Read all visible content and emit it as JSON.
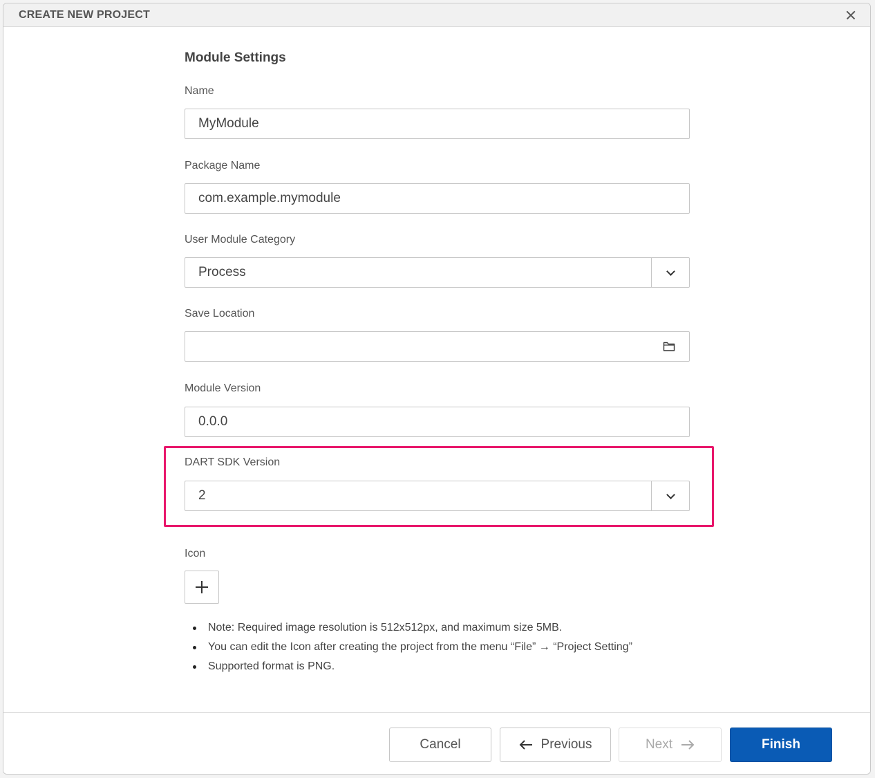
{
  "dialog": {
    "title": "CREATE NEW PROJECT"
  },
  "form": {
    "section_title": "Module Settings",
    "name": {
      "label": "Name",
      "value": "MyModule"
    },
    "package_name": {
      "label": "Package Name",
      "value": "com.example.mymodule"
    },
    "category": {
      "label": "User Module Category",
      "value": "Process"
    },
    "save_location": {
      "label": "Save Location",
      "value": ""
    },
    "module_version": {
      "label": "Module Version",
      "value": "0.0.0"
    },
    "sdk_version": {
      "label": "DART SDK Version",
      "value": "2"
    },
    "icon": {
      "label": "Icon"
    }
  },
  "notes": [
    "Note: Required image resolution is 512x512px, and maximum size 5MB.",
    "You can edit the Icon after creating the project from the menu “File” → “Project Setting”",
    "Supported format is PNG."
  ],
  "footer": {
    "cancel_label": "Cancel",
    "previous_label": "Previous",
    "next_label": "Next",
    "finish_label": "Finish"
  },
  "colors": {
    "accent": "#0a5bb5",
    "highlight": "#e8176b"
  }
}
